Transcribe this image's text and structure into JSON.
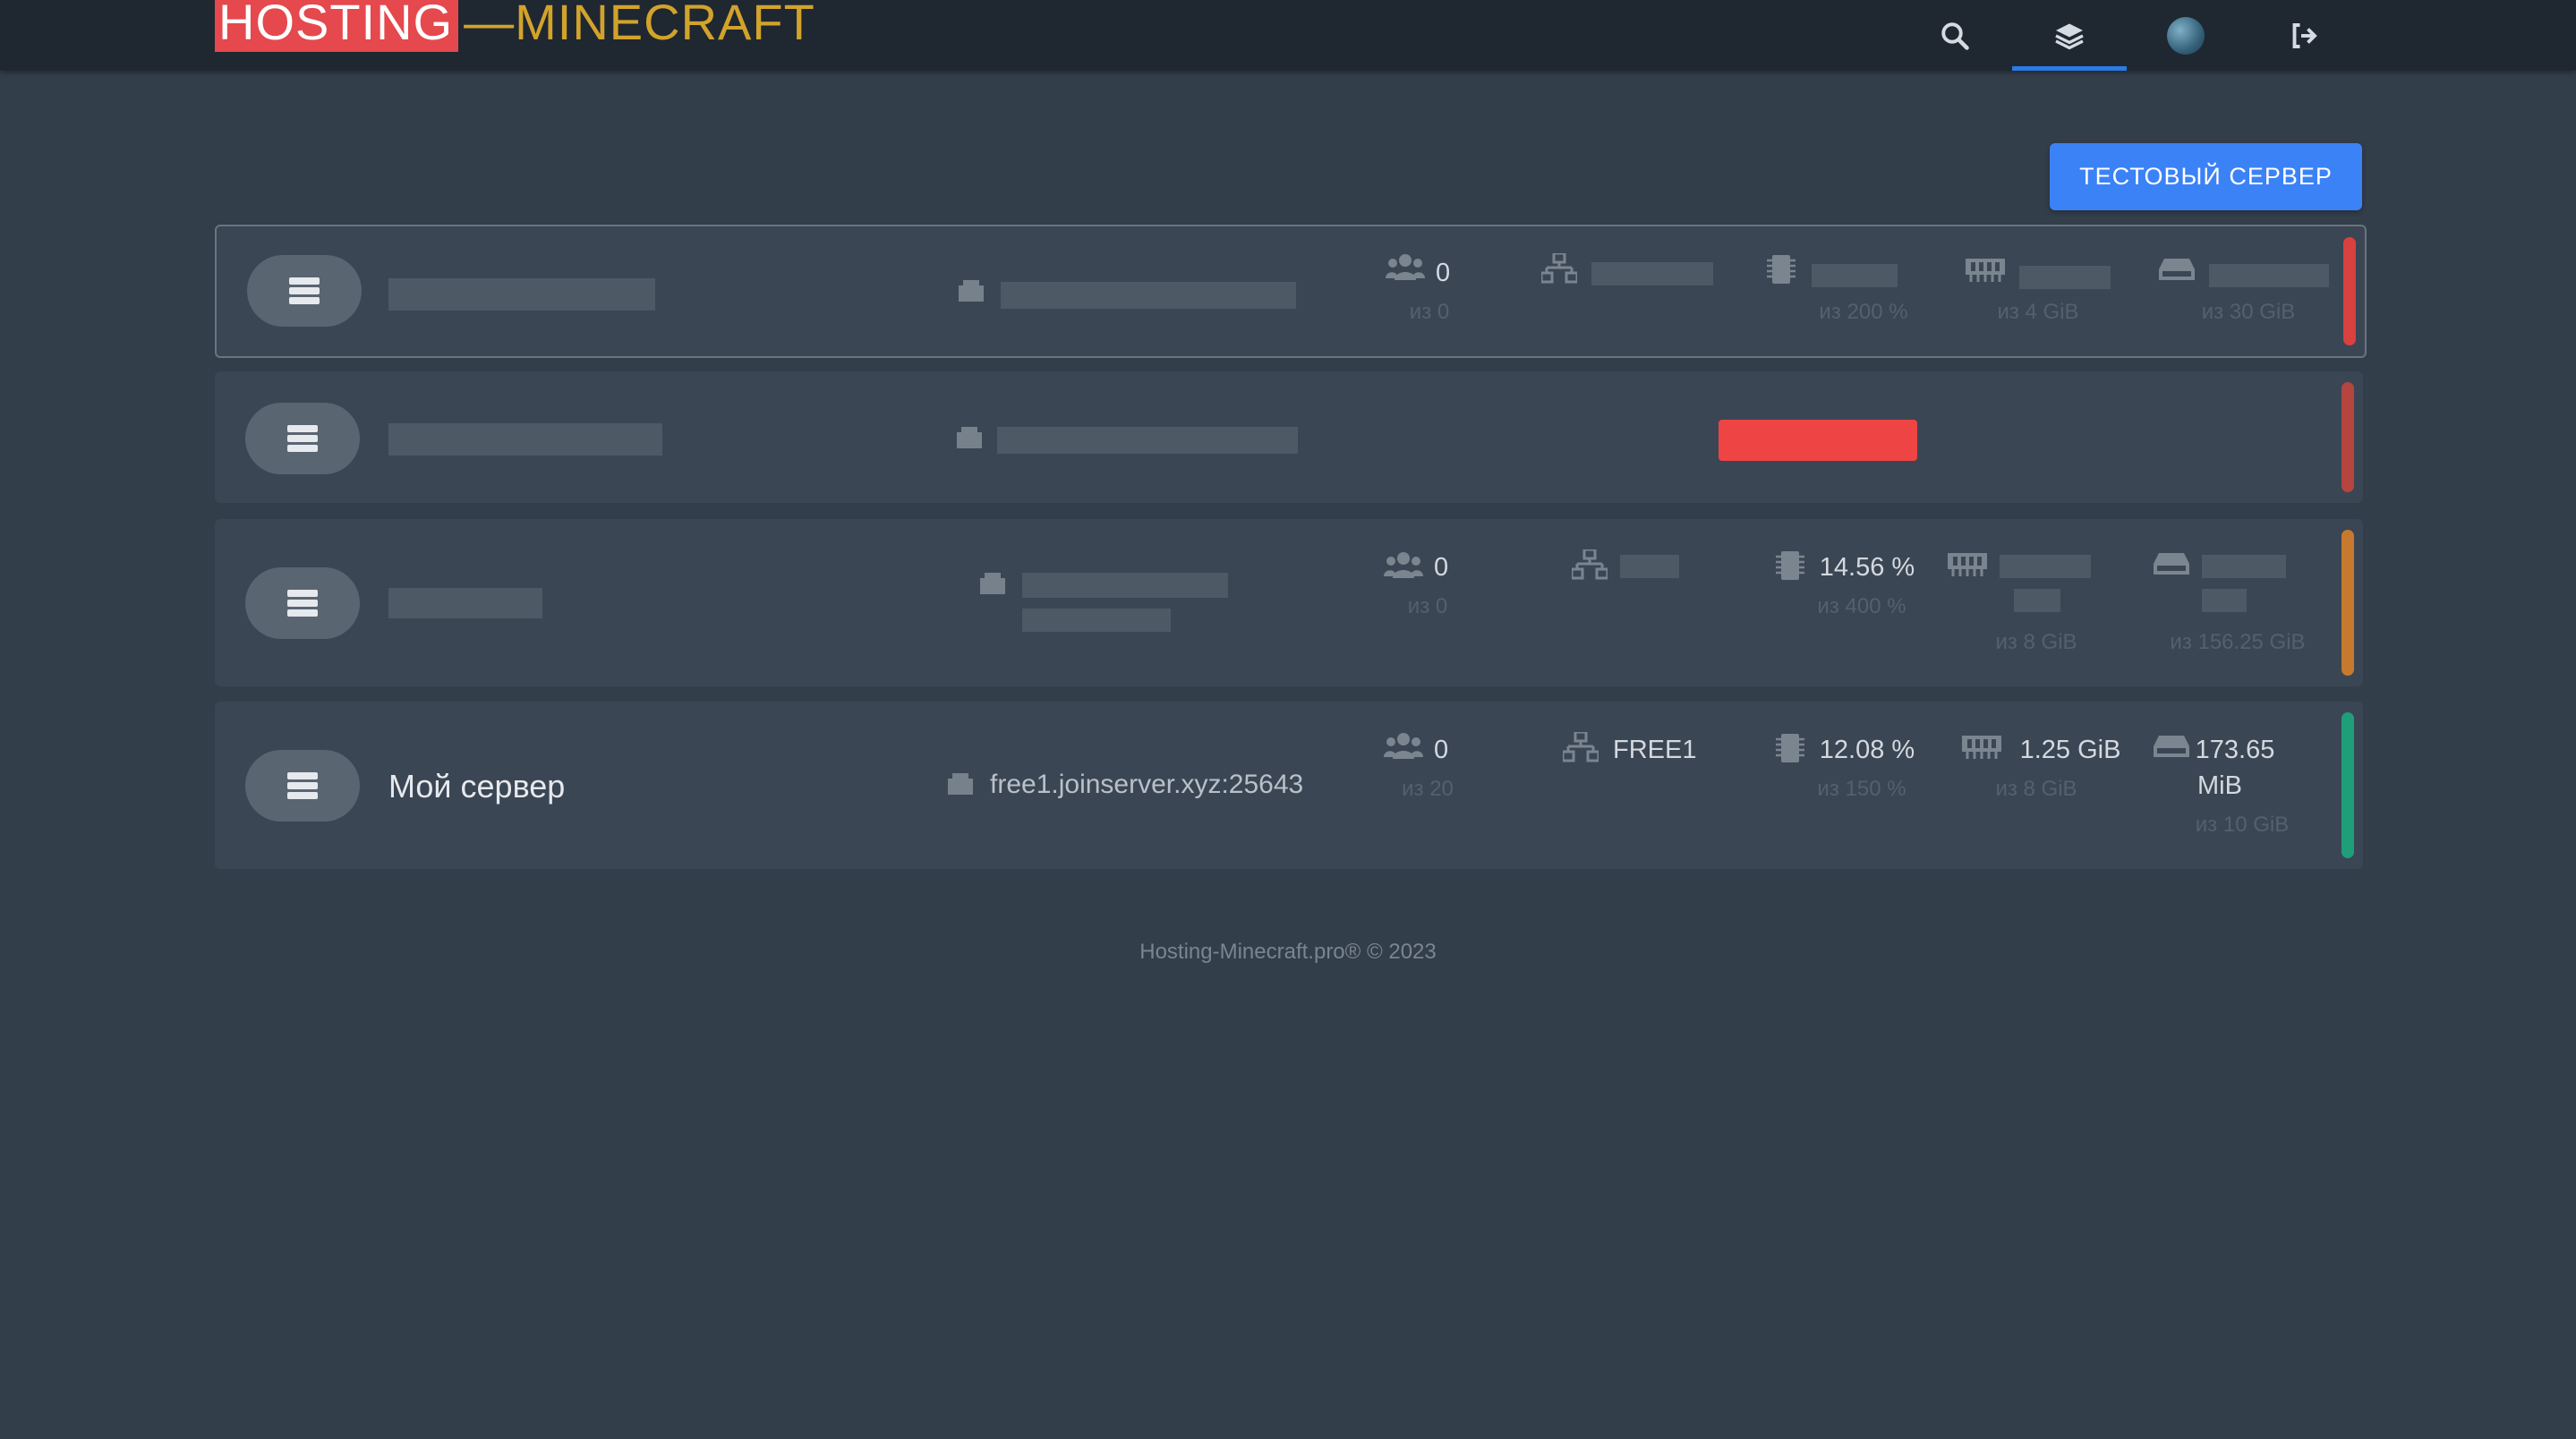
{
  "brand": {
    "part1": "HOSTING",
    "part2": "—MINECRAFT"
  },
  "nav": {
    "icons": [
      "search-icon",
      "layers-icon",
      "globe-avatar",
      "logout-icon"
    ],
    "active": "layers-icon"
  },
  "actions": {
    "test_server_label": "ТЕСТОВЫЙ СЕРВЕР"
  },
  "servers": [
    {
      "name": "",
      "address": "",
      "players": "0",
      "players_max": "из 0",
      "node": "",
      "cpu": "",
      "cpu_max": "из 200 %",
      "ram": "",
      "ram_max": "из 4 GiB",
      "disk": "",
      "disk_max": "из 30 GiB",
      "status_color": "#d9413e"
    },
    {
      "name": "",
      "address": "",
      "status_color": "#b5453f"
    },
    {
      "name": "",
      "address": "",
      "players": "0",
      "players_max": "из 0",
      "node": "",
      "cpu": "14.56 %",
      "cpu_max": "из 400 %",
      "ram": "",
      "ram_max": "из 8 GiB",
      "disk": "",
      "disk_max": "из 156.25 GiB",
      "status_color": "#c77a2e"
    },
    {
      "name": "Мой сервер",
      "address": "free1.joinserver.xyz:25643",
      "players": "0",
      "players_max": "из 20",
      "node": "FREE1",
      "cpu": "12.08 %",
      "cpu_max": "из 150 %",
      "ram": "1.25 GiB",
      "ram_max": "из 8 GiB",
      "disk_line1": "173.65",
      "disk_line2": "MiB",
      "disk_max": "из 10 GiB",
      "status_color": "#1f9e7a"
    }
  ],
  "footer": {
    "text": "Hosting-Minecraft.pro® © 2023"
  }
}
